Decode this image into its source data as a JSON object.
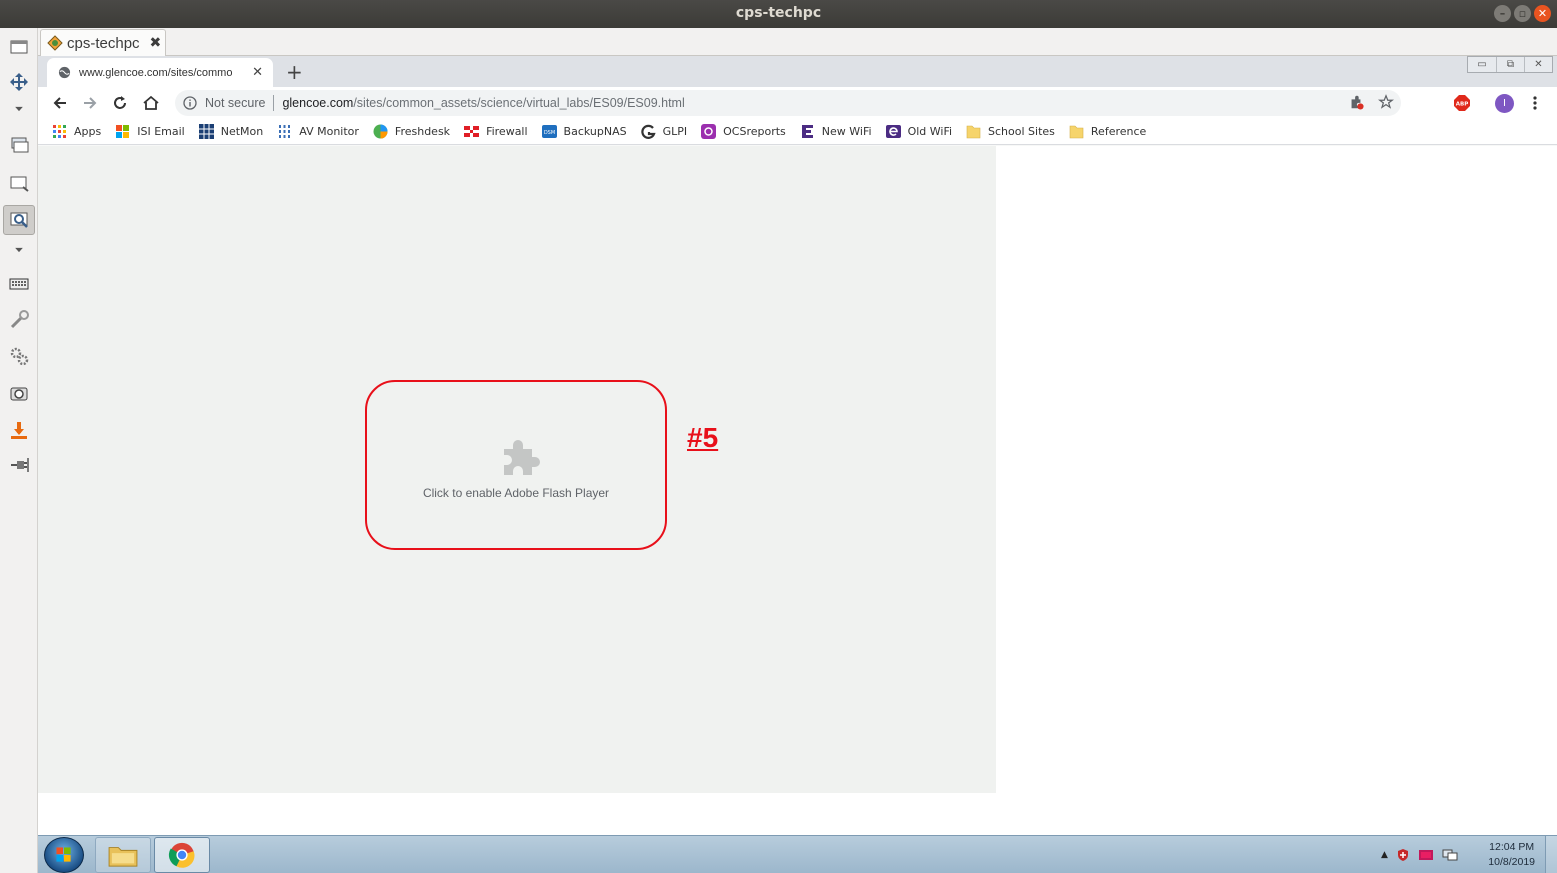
{
  "os_window": {
    "title": "cps-techpc"
  },
  "session_tab": {
    "label": "cps-techpc",
    "close": "✖"
  },
  "chrome": {
    "tab_title": "www.glencoe.com/sites/commo",
    "tab_close": "✕",
    "new_tab": "+",
    "window_controls": [
      "▭",
      "⧉",
      "✕"
    ],
    "omnibox": {
      "security_label": "Not secure",
      "url_host": "glencoe.com",
      "url_path": "/sites/common_assets/science/virtual_labs/ES09/ES09.html"
    },
    "profile_initial": "I",
    "bookmarks": [
      {
        "label": "Apps",
        "icon": "apps-grid-icon",
        "color": "#4285f4"
      },
      {
        "label": "ISI Email",
        "icon": "office-logo-icon",
        "color": "#eb3c00"
      },
      {
        "label": "NetMon",
        "icon": "netmon-grid-icon",
        "color": "#1b3f74"
      },
      {
        "label": "AV Monitor",
        "icon": "av-monitor-icon",
        "color": "#3b6fb6"
      },
      {
        "label": "Freshdesk",
        "icon": "freshdesk-icon",
        "color": "#4caf50"
      },
      {
        "label": "Firewall",
        "icon": "fortinet-icon",
        "color": "#e01e26"
      },
      {
        "label": "BackupNAS",
        "icon": "dsm-icon",
        "color": "#1f6fbf"
      },
      {
        "label": "GLPI",
        "icon": "glpi-icon",
        "color": "#333333"
      },
      {
        "label": "OCSreports",
        "icon": "ocs-icon",
        "color": "#9b2fae"
      },
      {
        "label": "New WiFi",
        "icon": "extreme-e-icon",
        "color": "#4b2c83"
      },
      {
        "label": "Old WiFi",
        "icon": "old-wifi-e-icon",
        "color": "#4b2c83"
      },
      {
        "label": "School Sites",
        "icon": "folder-icon",
        "color": "#f6d46b"
      },
      {
        "label": "Reference",
        "icon": "folder-icon",
        "color": "#f6d46b"
      }
    ]
  },
  "page": {
    "plugin_message": "Click to enable Adobe Flash Player",
    "annotation": "#5"
  },
  "taskbar": {
    "time": "12:04 PM",
    "date": "10/8/2019"
  },
  "colors": {
    "annotation_red": "#e8101a",
    "chrome_tabstrip": "#dee1e6",
    "taskbar_blue": "#a9c2d6"
  }
}
